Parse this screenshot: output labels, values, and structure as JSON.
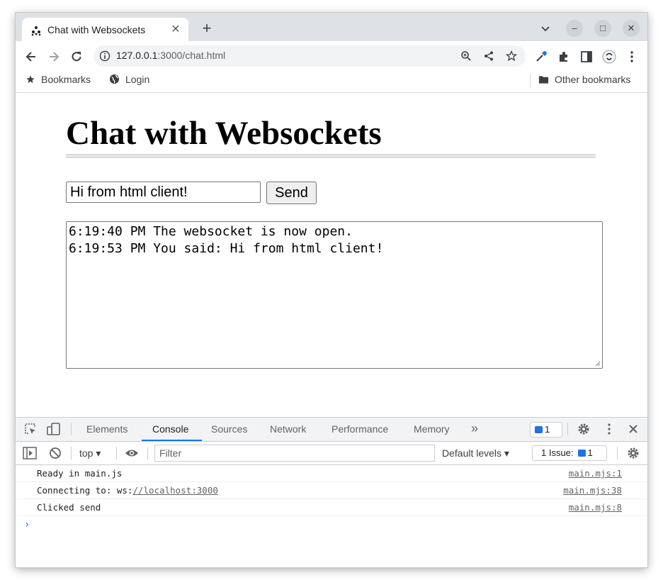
{
  "tab": {
    "title": "Chat with Websockets",
    "close_glyph": "✕"
  },
  "new_tab_glyph": "+",
  "window_controls": {
    "minimize": "–",
    "maximize": "□",
    "close": "✕"
  },
  "address": {
    "host": "127.0.0.1",
    "rest": ":3000/chat.html"
  },
  "bookmarks": {
    "bookmarks_label": "Bookmarks",
    "login_label": "Login",
    "other_label": "Other bookmarks"
  },
  "page": {
    "heading": "Chat with Websockets",
    "message_value": "Hi from html client!",
    "send_label": "Send",
    "log_lines": [
      "6:19:40 PM The websocket is now open.",
      "6:19:53 PM You said: Hi from html client!"
    ]
  },
  "devtools": {
    "tabs": [
      "Elements",
      "Console",
      "Sources",
      "Network",
      "Performance",
      "Memory"
    ],
    "active_tab": "Console",
    "more_tabs": "»",
    "message_badge_count": "1",
    "context": "top",
    "filter_placeholder": "Filter",
    "levels": "Default levels",
    "issues_label": "1 Issue:",
    "issues_count": "1",
    "console_lines": [
      {
        "prefix": "Ready in main.js",
        "link": "",
        "source": "main.mjs:1"
      },
      {
        "prefix": "Connecting to: ws:",
        "link": "//localhost:3000",
        "source": "main.mjs:38"
      },
      {
        "prefix": "Clicked send",
        "link": "",
        "source": "main.mjs:8"
      }
    ],
    "prompt": "›"
  },
  "colors": {
    "accent": "#1a73e8",
    "tabstrip": "#dee1e6",
    "omnibox": "#f1f3f4"
  }
}
